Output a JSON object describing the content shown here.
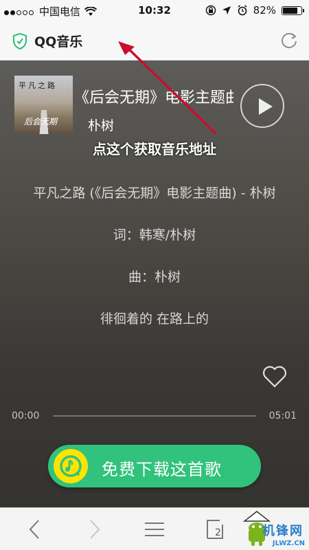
{
  "status_bar": {
    "carrier": "中国电信",
    "time": "10:32",
    "battery_percent": "82%",
    "signal_dots_filled": 2,
    "signal_dots_total": 5,
    "battery_level": 0.82
  },
  "nav": {
    "app_name": "QQ音乐",
    "brand_icon": "shield-check-icon",
    "refresh_icon": "refresh-icon"
  },
  "song": {
    "cover_title": "平凡之路",
    "cover_script": "后会无期",
    "title": "《后会无期》电影主题曲",
    "artist": "朴树"
  },
  "annotation": "点这个获取音乐地址",
  "lyrics": [
    "平凡之路 (《后会无期》电影主题曲) - 朴树",
    "词：韩寒/朴树",
    "曲：朴树",
    "徘徊着的 在路上的"
  ],
  "progress": {
    "current": "00:00",
    "total": "05:01",
    "fraction": 0
  },
  "download_button": {
    "label": "免费下载这首歌"
  },
  "toolbar": {
    "page_count": "2"
  },
  "watermark": {
    "text_cn": "机锋网",
    "text_url": "JLWZ.CN"
  },
  "colors": {
    "accent_green": "#31c27c",
    "logo_yellow": "#ffe400",
    "arrow_red": "#c8102e"
  }
}
